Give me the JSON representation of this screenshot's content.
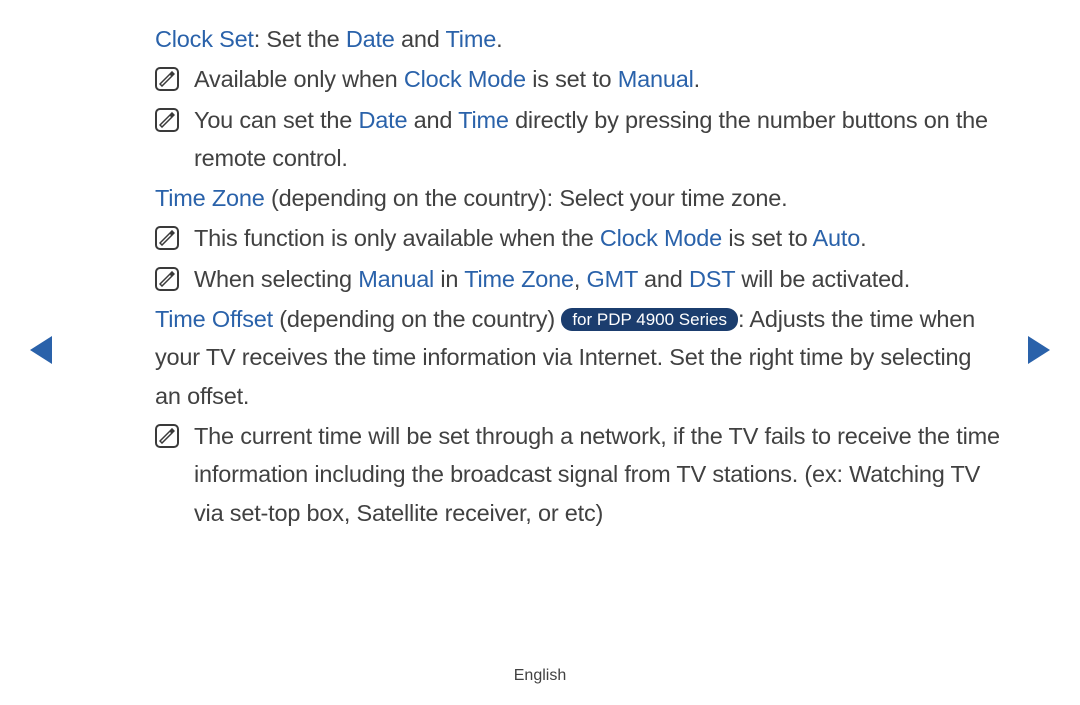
{
  "sections": {
    "clock_set": {
      "label": "Clock Set",
      "desc_pre": ": Set the ",
      "term_date": "Date",
      "desc_mid": " and ",
      "term_time": "Time",
      "desc_post": ".",
      "note1_pre": "Available only when ",
      "note1_term1": "Clock Mode",
      "note1_mid": " is set to ",
      "note1_term2": "Manual",
      "note1_post": ".",
      "note2_pre": "You can set the ",
      "note2_term1": "Date",
      "note2_mid": " and ",
      "note2_term2": "Time",
      "note2_post": " directly by pressing the number buttons on the remote control."
    },
    "time_zone": {
      "label": "Time Zone",
      "desc": " (depending on the country): Select your time zone.",
      "note1_pre": "This function is only available when the ",
      "note1_term1": "Clock Mode",
      "note1_mid": " is set to ",
      "note1_term2": "Auto",
      "note1_post": ".",
      "note2_pre": "When selecting ",
      "note2_term1": "Manual",
      "note2_mid1": " in ",
      "note2_term2": "Time Zone",
      "note2_mid2": ", ",
      "note2_term3": "GMT",
      "note2_mid3": " and ",
      "note2_term4": "DST",
      "note2_post": " will be activated."
    },
    "time_offset": {
      "label": "Time Offset",
      "desc_pre": " (depending on the country) ",
      "badge": "for PDP 4900 Series",
      "desc_post": ": Adjusts the time when your TV receives the time information via Internet. Set the right time by selecting an offset.",
      "note1": "The current time will be set through a network, if the TV fails to receive the time information including the broadcast signal from TV stations. (ex: Watching TV via set-top box, Satellite receiver, or etc)"
    }
  },
  "footer": "English"
}
